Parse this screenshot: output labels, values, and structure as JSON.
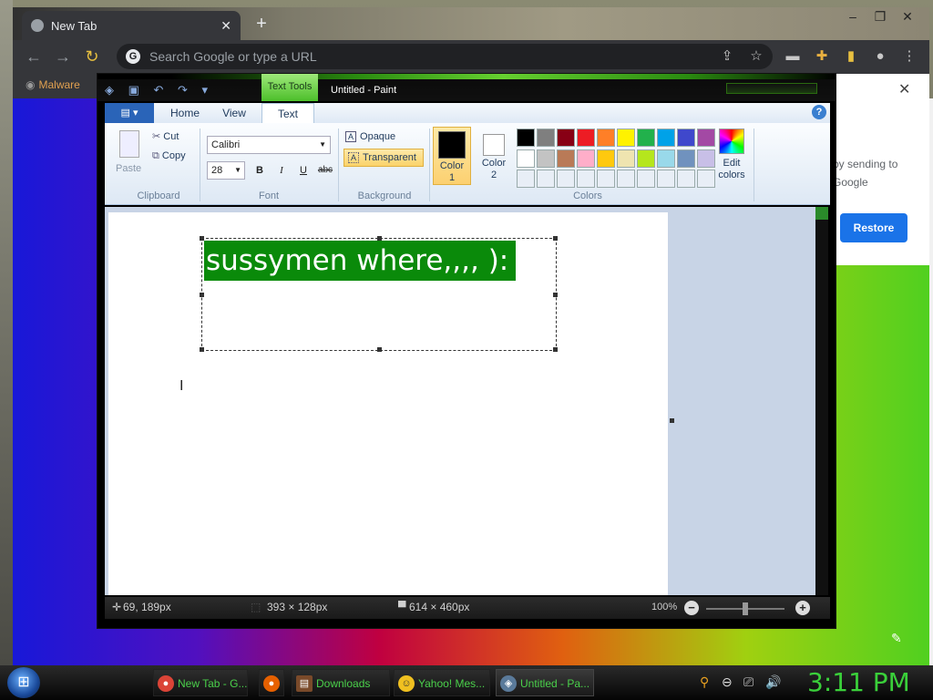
{
  "chrome": {
    "tab_title": "New Tab",
    "tab_close": "✕",
    "new_tab": "+",
    "omnibox_placeholder": "Search Google or type a URL",
    "bookmark_label": "Malware",
    "restore_text": "by sending to Google",
    "restore_button": "Restore",
    "popup_close": "✕"
  },
  "paint": {
    "contextual_tab": "Text Tools",
    "title": "Untitled - Paint",
    "tabs": {
      "home": "Home",
      "view": "View",
      "text": "Text"
    },
    "clipboard": {
      "paste": "Paste",
      "cut": "Cut",
      "copy": "Copy",
      "group": "Clipboard"
    },
    "font": {
      "family": "Calibri",
      "size": "28",
      "bold": "B",
      "italic": "I",
      "underline": "U",
      "strike": "abc",
      "group": "Font"
    },
    "background": {
      "opaque": "Opaque",
      "transparent": "Transparent",
      "group": "Background"
    },
    "colors": {
      "color1_line1": "Color",
      "color1_line2": "1",
      "color2_line1": "Color",
      "color2_line2": "2",
      "edit_line1": "Edit",
      "edit_line2": "colors",
      "group": "Colors",
      "palette": [
        "#000000",
        "#7f7f7f",
        "#880015",
        "#ed1c24",
        "#ff7f27",
        "#fff200",
        "#22b14c",
        "#00a2e8",
        "#3f48cc",
        "#a349a4",
        "#ffffff",
        "#c3c3c3",
        "#b97a57",
        "#ffaec9",
        "#ffc90e",
        "#efe4b0",
        "#b5e61d",
        "#99d9ea",
        "#7092be",
        "#c8bfe7",
        "#e8eef6",
        "#e8eef6",
        "#e8eef6",
        "#e8eef6",
        "#e8eef6",
        "#e8eef6",
        "#e8eef6",
        "#e8eef6",
        "#e8eef6",
        "#e8eef6"
      ]
    },
    "canvas_text": "sussymen where,,,, ):",
    "status": {
      "cursor_pos": "69, 189px",
      "selection_size": "393 × 128px",
      "image_size": "614 × 460px",
      "zoom": "100%"
    }
  },
  "taskbar": {
    "items": [
      {
        "label": "New Tab - G..."
      },
      {
        "label": "Downloads"
      },
      {
        "label": "Yahoo! Mes..."
      },
      {
        "label": "Untitled - Pa..."
      }
    ],
    "clock": "3:11 PM"
  }
}
